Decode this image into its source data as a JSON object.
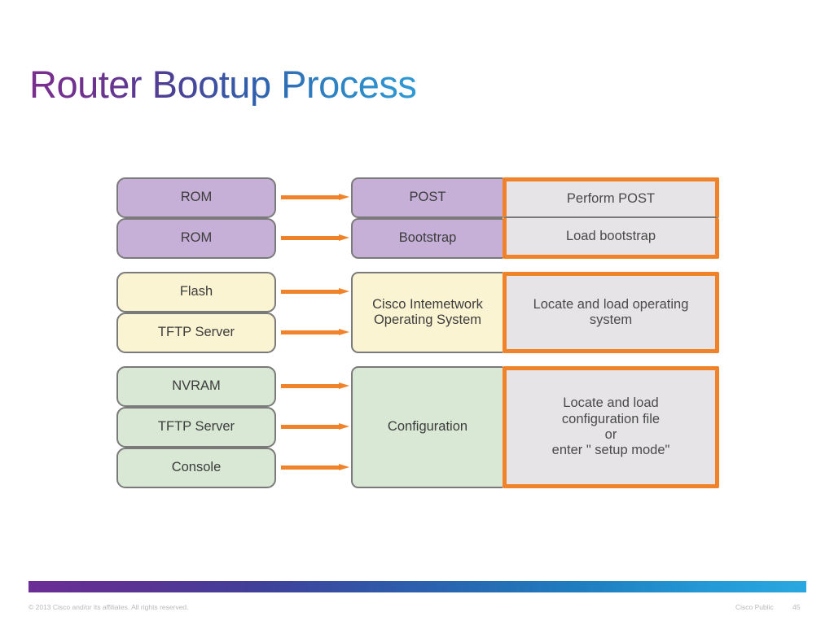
{
  "slide": {
    "title": "Router Bootup Process"
  },
  "diagram": {
    "groups": [
      {
        "name": "rom-group",
        "color": "purple",
        "sources": [
          "ROM",
          "ROM"
        ],
        "stages": [
          "POST",
          "Bootstrap"
        ],
        "actions": [
          "Perform POST",
          "Load bootstrap"
        ]
      },
      {
        "name": "ios-group",
        "color": "cream",
        "sources": [
          "Flash",
          "TFTP Server"
        ],
        "stages": [
          "Cisco Intemetwork Operating System"
        ],
        "stage_lines": [
          "Cisco Intemetwork",
          "Operating System"
        ],
        "actions": [
          "Locate and load operating system"
        ],
        "action_lines": [
          "Locate and load operating",
          "system"
        ]
      },
      {
        "name": "configuration-group",
        "color": "green",
        "sources": [
          "NVRAM",
          "TFTP Server",
          "Console"
        ],
        "stages": [
          "Configuration"
        ],
        "actions": [
          "Locate and load configuration file or enter \" setup mode\""
        ],
        "action_lines": [
          "Locate and load",
          "configuration file",
          "or",
          "enter \" setup mode\""
        ]
      }
    ]
  },
  "footer": {
    "copyright": "© 2013 Cisco and/or its affiliates. All rights reserved.",
    "classification": "Cisco Public",
    "page_number": "45"
  },
  "colors": {
    "purple_fill": "#c6b0d8",
    "cream_fill": "#fbf4d2",
    "green_fill": "#d8e8d4",
    "action_fill": "#e6e4e6",
    "accent_orange": "#f0832a",
    "node_border": "#7a7a7a",
    "title_gradient_start": "#7b2d8e",
    "title_gradient_end": "#2f9ad4"
  }
}
